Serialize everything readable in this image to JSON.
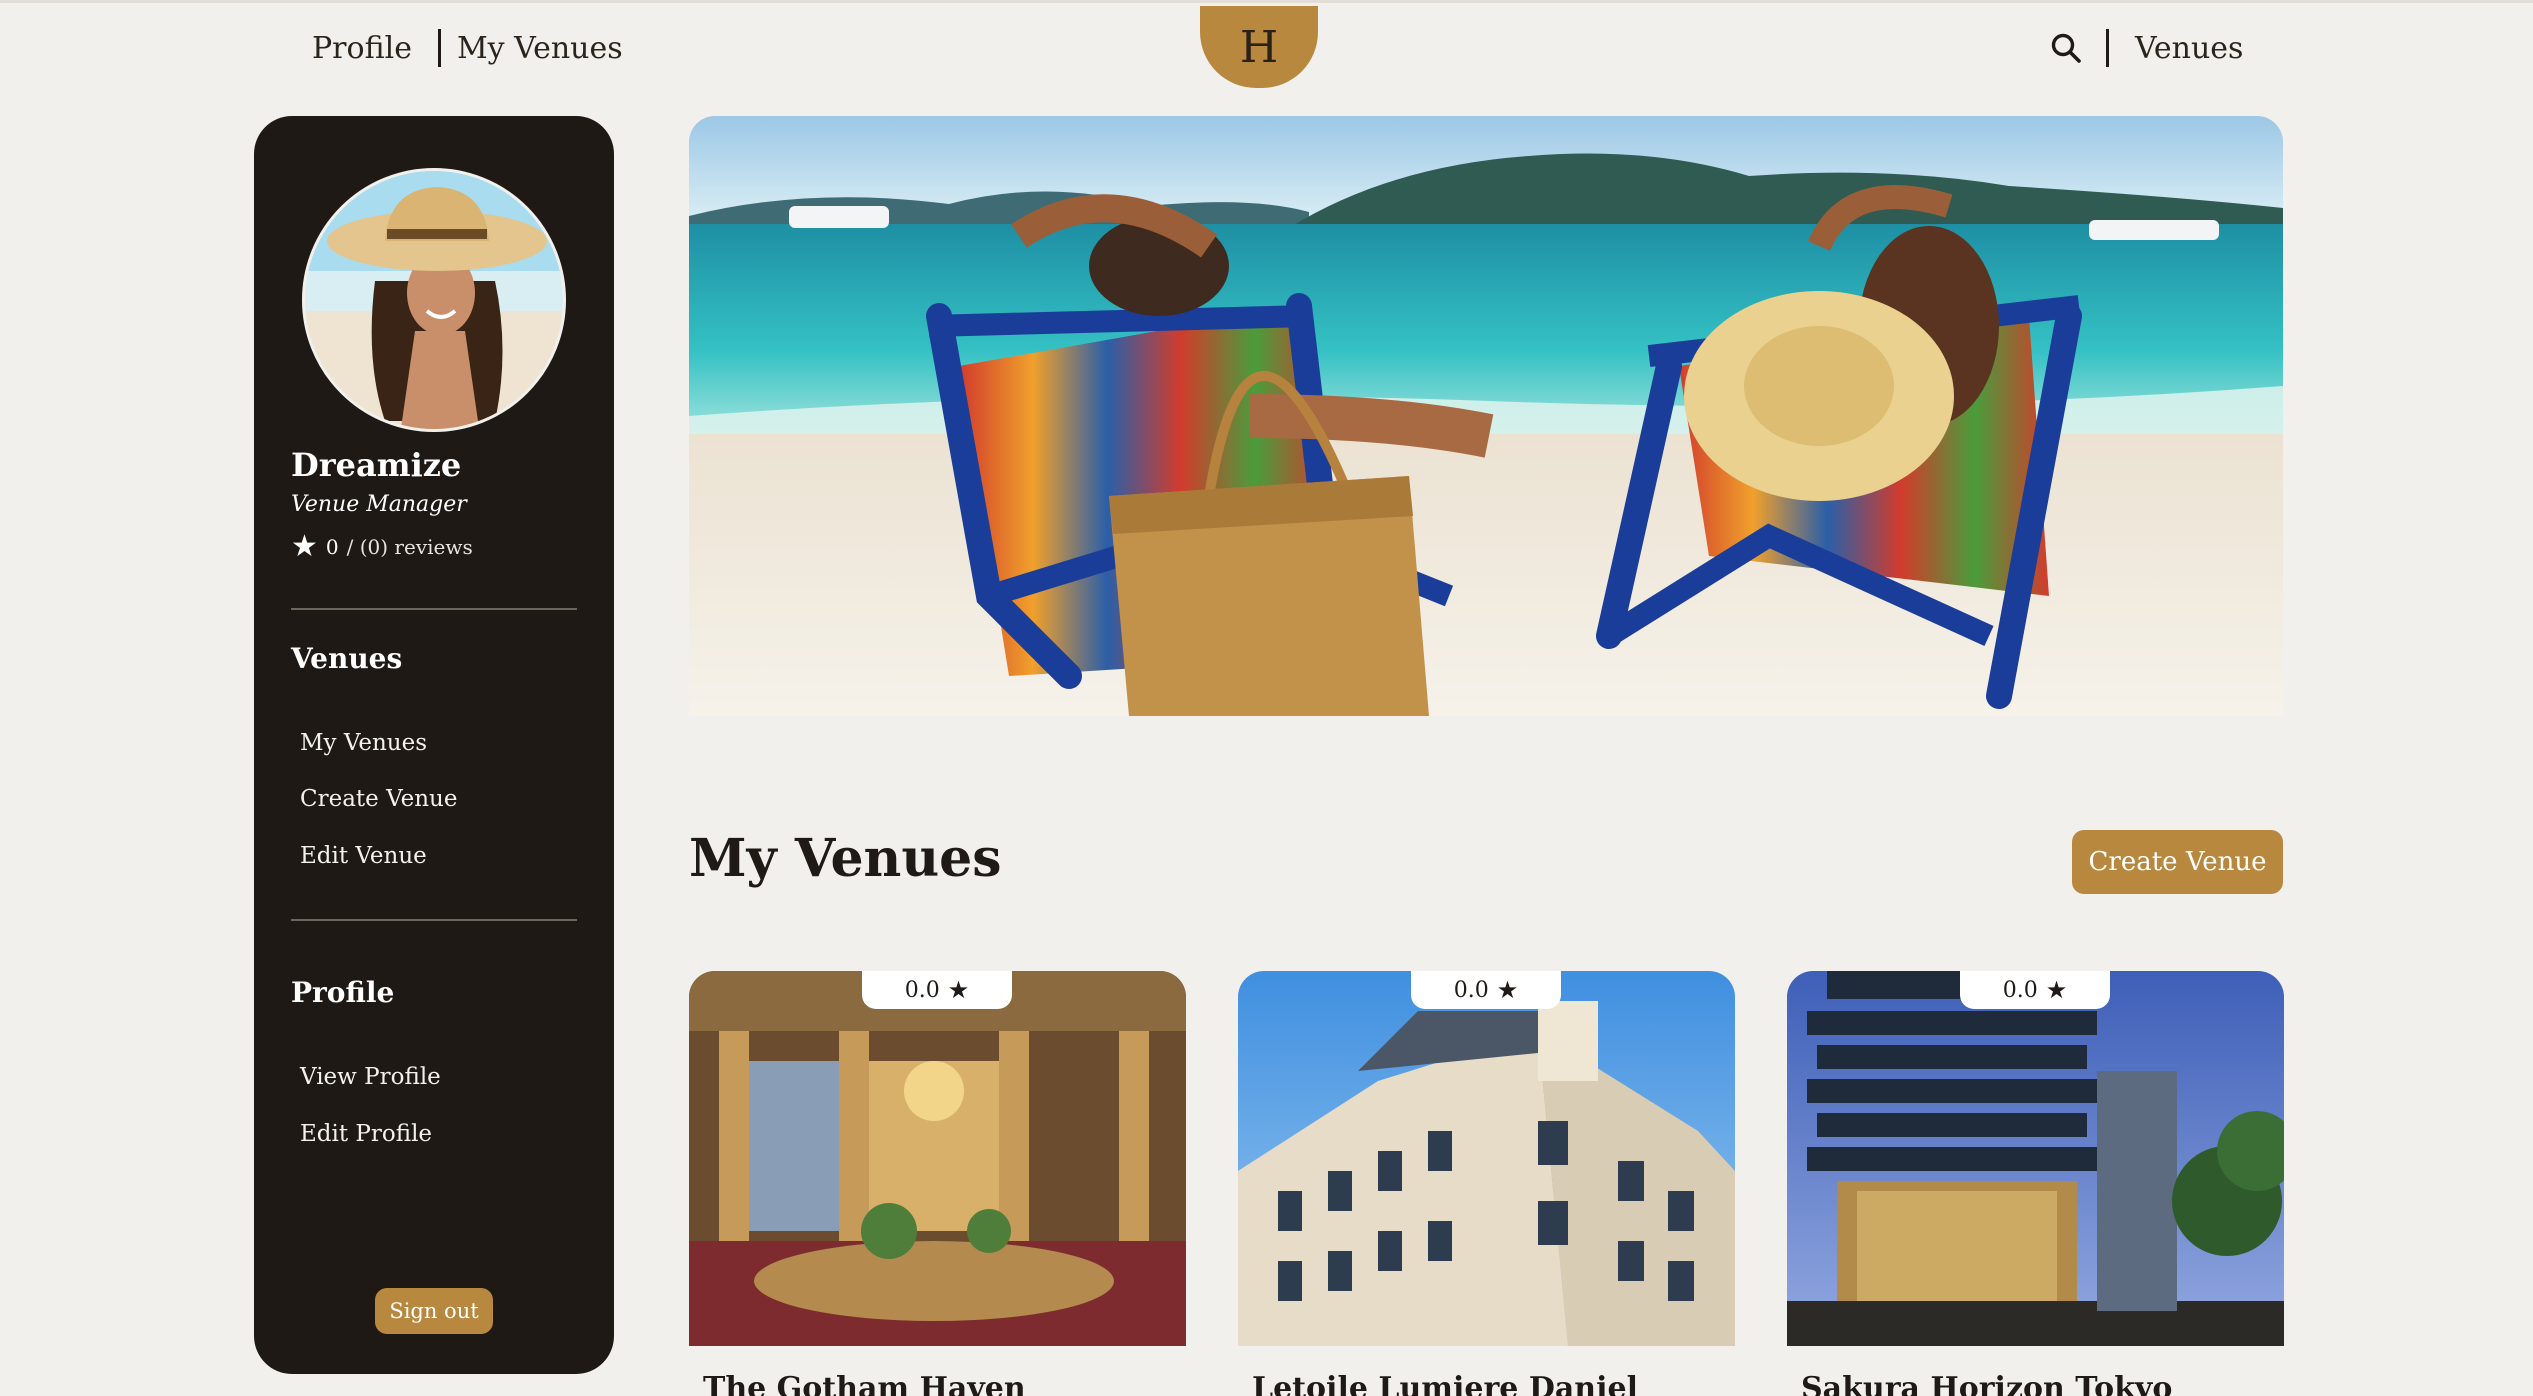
{
  "nav": {
    "profile_label": "Profile",
    "my_venues_label": "My Venues",
    "logo_letter": "H",
    "venues_label": "Venues",
    "search_icon": "search-icon"
  },
  "sidebar": {
    "name": "Dreamize",
    "role": "Venue Manager",
    "rating_value": "0",
    "rating_reviews": "/ (0) reviews",
    "venues_heading": "Venues",
    "venues_items": [
      {
        "label": "My Venues"
      },
      {
        "label": "Create Venue"
      },
      {
        "label": "Edit Venue"
      }
    ],
    "profile_heading": "Profile",
    "profile_items": [
      {
        "label": "View Profile"
      },
      {
        "label": "Edit Profile"
      }
    ],
    "signout_label": "Sign out"
  },
  "main": {
    "section_title": "My Venues",
    "create_button_label": "Create Venue",
    "venues": [
      {
        "name": "The Gotham Haven",
        "rating": "0.0"
      },
      {
        "name": "Letoile Lumiere Daniel",
        "rating": "0.0"
      },
      {
        "name": "Sakura Horizon Tokyo",
        "rating": "0.0"
      }
    ]
  },
  "colors": {
    "accent": "#b8883e",
    "sidebar_bg": "#1e1915",
    "page_bg": "#f2f0ed"
  }
}
